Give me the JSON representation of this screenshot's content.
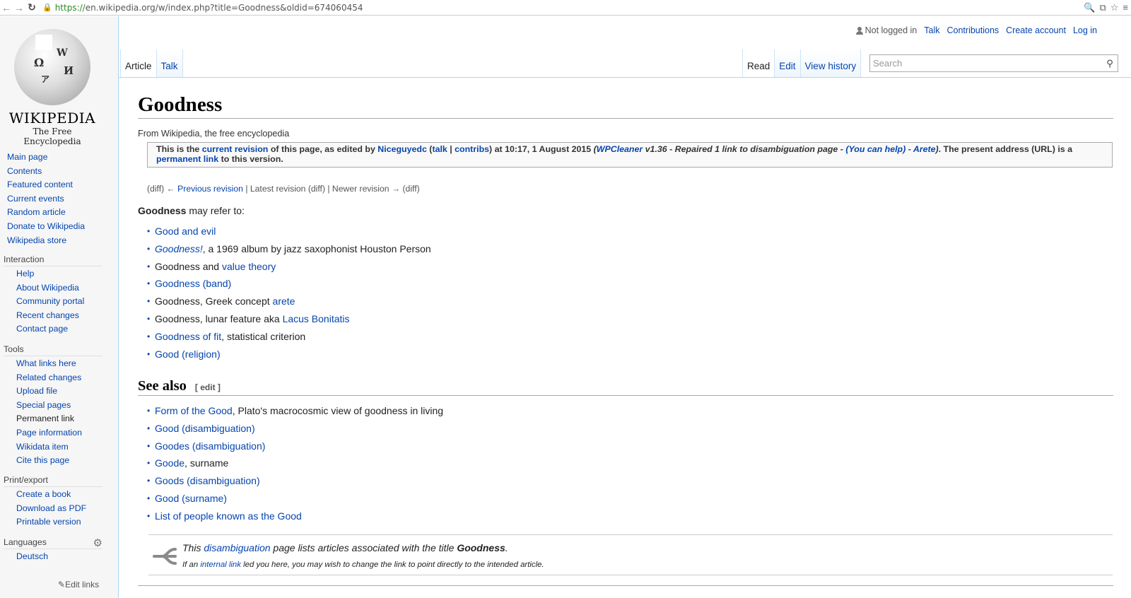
{
  "browser": {
    "url_proto": "https://",
    "url_rest": "en.wikipedia.org/w/index.php?title=Goodness&oldid=674060454"
  },
  "logo": {
    "wordmark": "WIKIPEDIA",
    "tagline": "The Free Encyclopedia"
  },
  "sidebar": {
    "nav": [
      "Main page",
      "Contents",
      "Featured content",
      "Current events",
      "Random article",
      "Donate to Wikipedia",
      "Wikipedia store"
    ],
    "interaction": {
      "title": "Interaction",
      "items": [
        "Help",
        "About Wikipedia",
        "Community portal",
        "Recent changes",
        "Contact page"
      ]
    },
    "tools": {
      "title": "Tools",
      "items": [
        "What links here",
        "Related changes",
        "Upload file",
        "Special pages",
        "Permanent link",
        "Page information",
        "Wikidata item",
        "Cite this page"
      ]
    },
    "print": {
      "title": "Print/export",
      "items": [
        "Create a book",
        "Download as PDF",
        "Printable version"
      ]
    },
    "languages": {
      "title": "Languages",
      "items": [
        "Deutsch"
      ],
      "edit_links": "Edit links"
    }
  },
  "personal": {
    "not_logged_in": "Not logged in",
    "talk": "Talk",
    "contributions": "Contributions",
    "create_account": "Create account",
    "log_in": "Log in"
  },
  "tabs": {
    "article": "Article",
    "talk": "Talk",
    "read": "Read",
    "edit": "Edit",
    "view_history": "View history"
  },
  "search": {
    "placeholder": "Search"
  },
  "page": {
    "title": "Goodness",
    "from": "From Wikipedia, the free encyclopedia",
    "rev": {
      "t1": "This is the ",
      "current_revision": "current revision",
      "t2": " of this page, as edited by ",
      "user": "Niceguyedc",
      "t3": " (",
      "talk": "talk",
      "sep": " | ",
      "contribs": "contribs",
      "t4": ") at 10:17, 1 August 2015 ",
      "paren_open": "(",
      "wpcleaner": "WPCleaner",
      "summary": " v1.36 - Repaired 1 link to disambiguation page - ",
      "you_can_help": "(You can help)",
      "dash": " - ",
      "arete": "Arete",
      "paren_close": ")",
      "t5": ". The present address (URL) is a",
      "permanent_link": "permanent link",
      "t6": " to this version."
    },
    "revnav": "(diff) ← Previous revision | Latest revision (diff) | Newer revision → (diff)",
    "revnav_prev": "Previous revision",
    "revnav_a": "(diff) ← ",
    "revnav_b": " | Latest revision (diff) | Newer revision → (diff)",
    "lede_bold": "Goodness",
    "lede_rest": " may refer to:",
    "refer_items": [
      {
        "link": "Good and evil",
        "text": ""
      },
      {
        "link": "Goodness!",
        "text": ", a 1969 album by jazz saxophonist Houston Person"
      },
      {
        "pre": "Goodness and ",
        "link": "value theory",
        "text": ""
      },
      {
        "link": "Goodness (band)",
        "text": ""
      },
      {
        "pre": "Goodness, Greek concept ",
        "link": "arete",
        "text": ""
      },
      {
        "pre": "Goodness, lunar feature aka ",
        "link": "Lacus Bonitatis",
        "text": ""
      },
      {
        "link": "Goodness of fit",
        "text": ", statistical criterion"
      },
      {
        "link": "Good (religion)",
        "text": ""
      }
    ],
    "see_also": "See also",
    "edit_section": "[ edit ]",
    "see_items": [
      {
        "link": "Form of the Good",
        "text": ", Plato's macrocosmic view of goodness in living"
      },
      {
        "link": "Good (disambiguation)",
        "text": ""
      },
      {
        "link": "Goodes (disambiguation)",
        "text": ""
      },
      {
        "link": "Goode",
        "text": ", surname"
      },
      {
        "link": "Goods (disambiguation)",
        "text": ""
      },
      {
        "link": "Good (surname)",
        "text": ""
      },
      {
        "link": "List of people known as the Good",
        "text": ""
      }
    ],
    "dab": {
      "a": "This ",
      "link": "disambiguation",
      "b": " page lists articles associated with the title ",
      "title": "Goodness",
      "c": ".",
      "small_a": "If an ",
      "small_link": "internal link",
      "small_b": " led you here, you may wish to change the link to point directly to the intended article."
    }
  }
}
